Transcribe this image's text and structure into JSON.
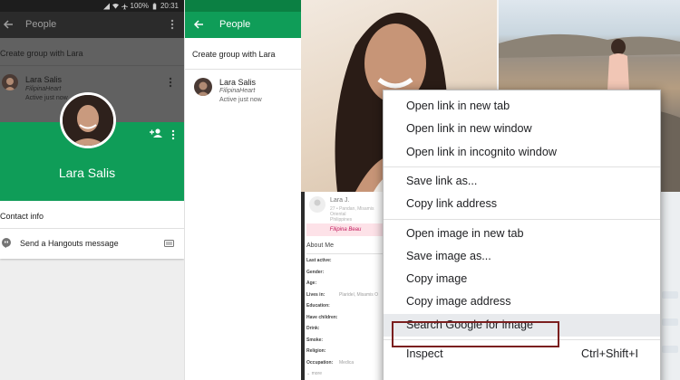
{
  "panel1": {
    "status": {
      "battery": "100%",
      "time": "20:31"
    },
    "title": "People",
    "create_group": "Create group with Lara",
    "contact": {
      "name": "Lara Salis",
      "subtitle": "FilipinaHeart",
      "status": "Active just now"
    },
    "profile_name": "Lara Salis",
    "contact_info": "Contact info",
    "hangouts_action": "Send a Hangouts message",
    "icons": [
      "back-arrow-icon",
      "more-vert-icon",
      "add-person-icon",
      "hangouts-icon",
      "video-icon",
      "wifi-icon",
      "airplane-icon",
      "battery-icon",
      "signal-icon"
    ]
  },
  "panel2": {
    "title": "People",
    "create_group": "Create group with Lara",
    "contact": {
      "name": "Lara Salis",
      "subtitle": "FilipinaHeart",
      "status": "Active just now"
    }
  },
  "panel3": {
    "profile_card": {
      "name": "Lara J.",
      "sub1": "27 • Pandan, Misamis Oriental",
      "sub2": "Philippines"
    },
    "badge": "Filipina Beau",
    "about_title": "About Me",
    "about_rows": [
      {
        "label": "Last active:",
        "value": ""
      },
      {
        "label": "Gender:",
        "value": ""
      },
      {
        "label": "Age:",
        "value": ""
      },
      {
        "label": "Lives in:",
        "value": "Plaridel, Misamis O"
      },
      {
        "label": "Education:",
        "value": ""
      },
      {
        "label": "Have children:",
        "value": ""
      },
      {
        "label": "Drink:",
        "value": ""
      },
      {
        "label": "Smoke:",
        "value": ""
      },
      {
        "label": "Religion:",
        "value": ""
      },
      {
        "label": "Occupation:",
        "value": "Medica"
      }
    ],
    "more": "more"
  },
  "context_menu": {
    "groups": [
      [
        "Open link in new tab",
        "Open link in new window",
        "Open link in incognito window"
      ],
      [
        "Save link as...",
        "Copy link address"
      ],
      [
        "Open image in new tab",
        "Save image as...",
        "Copy image",
        "Copy image address",
        "Search Google for image"
      ]
    ],
    "inspect": {
      "label": "Inspect",
      "shortcut": "Ctrl+Shift+I"
    },
    "highlighted": "Search Google for image",
    "highlight_color": "#7b1f1f",
    "hover_bg": "#e8eaed"
  },
  "colors": {
    "green": "#0f9d58",
    "dark_green": "#0b8043",
    "appbar_dark": "#2b2b2b"
  }
}
